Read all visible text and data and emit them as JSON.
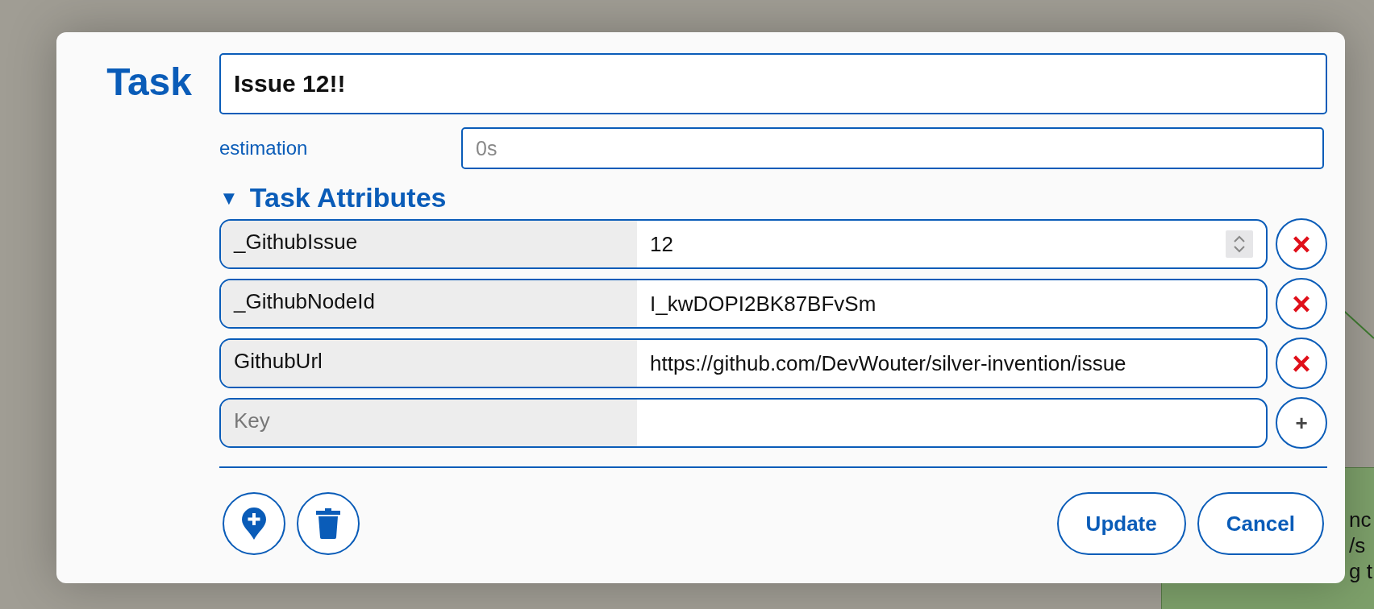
{
  "dialog": {
    "heading": "Task",
    "title_value": "Issue 12!!",
    "estimation": {
      "label": "estimation",
      "placeholder": "0s"
    },
    "attributes": {
      "label": "Task Attributes",
      "triangle": "▼",
      "expanded": true,
      "rows": [
        {
          "kind": "number",
          "key": "_GithubIssue",
          "value": "12",
          "action": "×"
        },
        {
          "kind": "text",
          "key": "_GithubNodeId",
          "value": "I_kwDOPI2BK87BFvSm",
          "action": "×"
        },
        {
          "kind": "text",
          "key": "GithubUrl",
          "value": "https://github.com/DevWouter/silver-invention/issue",
          "action": "×"
        },
        {
          "kind": "new",
          "key_placeholder": "Key",
          "action": "+"
        }
      ]
    },
    "buttons": [
      "Update",
      "Cancel"
    ]
  },
  "background_node": {
    "lines": [
      "nc",
      "/s",
      "g t"
    ]
  }
}
